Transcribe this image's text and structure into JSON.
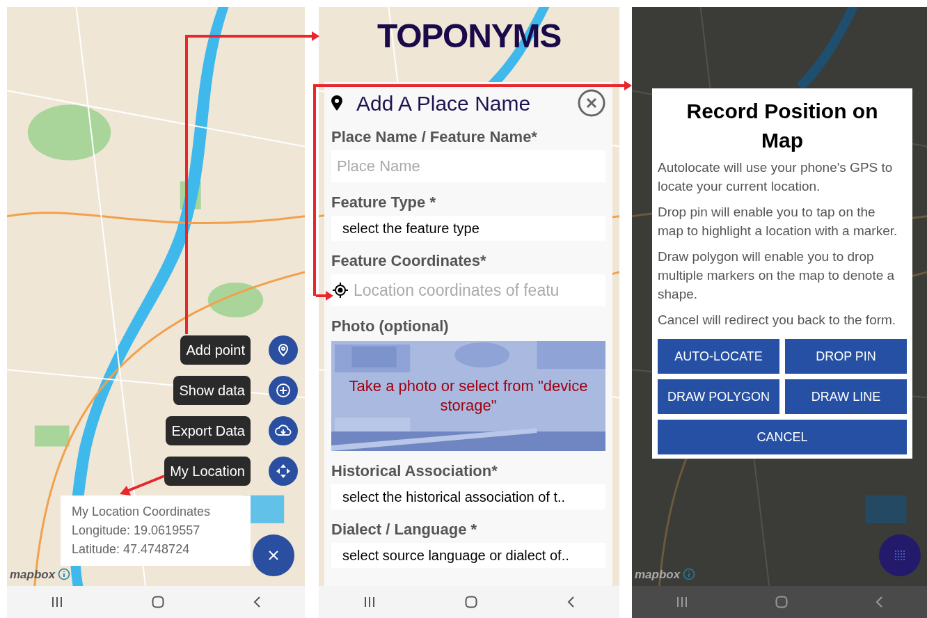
{
  "map_screen": {
    "actions": [
      {
        "label": "Add point"
      },
      {
        "label": "Show data"
      },
      {
        "label": "Export Data"
      },
      {
        "label": "My Location"
      }
    ],
    "location_info": {
      "title": "My Location Coordinates",
      "longitude": "Longitude: 19.0619557",
      "latitude": "Latitude: 47.4748724"
    },
    "attribution": "mapbox"
  },
  "form_screen": {
    "app_title": "TOPONYMS",
    "form_title": "Add A Place Name",
    "fields": [
      {
        "kind": "text",
        "label": "Place Name / Feature Name*",
        "placeholder": "Place Name"
      },
      {
        "kind": "select",
        "label": "Feature Type *",
        "value": "select the feature type"
      },
      {
        "kind": "location",
        "label": "Feature Coordinates*",
        "placeholder": "Location coordinates of featu"
      },
      {
        "label": "Photo (optional)",
        "prompt": "Take a photo or select from \"device storage\""
      },
      {
        "kind": "select",
        "label": "Historical Association*",
        "value": "select the historical association of t.."
      },
      {
        "kind": "select",
        "label": "Dialect / Language *",
        "value": "select source language or dialect of.."
      }
    ]
  },
  "dialog_screen": {
    "title": "Record Position on Map",
    "paragraphs": [
      "Autolocate will use your phone's GPS to locate your current location.",
      "Drop pin will enable you to tap on the map to highlight a location with a marker.",
      "Draw polygon will enable you to drop multiple markers on the map to denote a shape.",
      "Cancel will redirect you back to the form."
    ],
    "buttons": [
      "AUTO-LOCATE",
      "DROP PIN",
      "DRAW POLYGON",
      "DRAW LINE",
      "CANCEL"
    ],
    "attribution": "mapbox"
  }
}
